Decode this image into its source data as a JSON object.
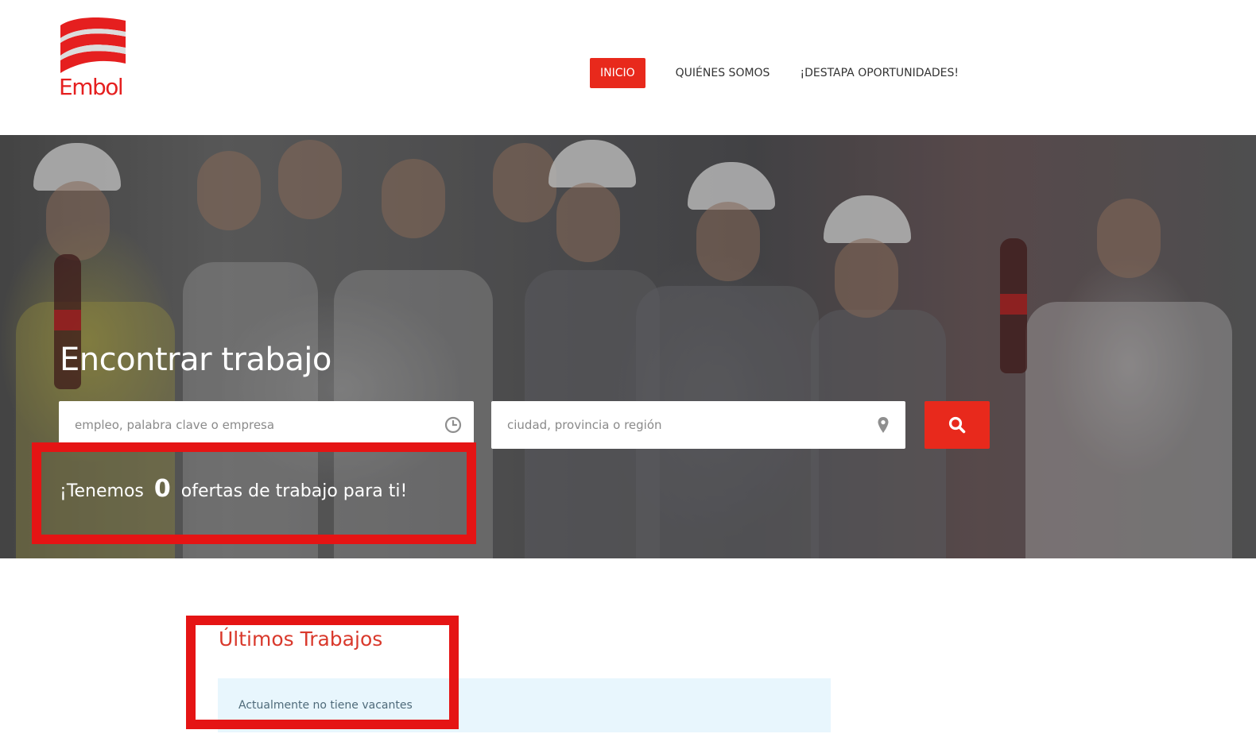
{
  "brand": {
    "logo_text": "Embol",
    "accent_color": "#e8291c"
  },
  "nav": {
    "items": [
      {
        "label": "INICIO",
        "active": true
      },
      {
        "label": "QUIÉNES SOMOS",
        "active": false
      },
      {
        "label": "¡DESTAPA OPORTUNIDADES!",
        "active": false
      }
    ]
  },
  "hero": {
    "title": "Encontrar trabajo",
    "keyword_placeholder": "empleo, palabra clave o empresa",
    "keyword_icon": "clock-icon",
    "location_placeholder": "ciudad, provincia o región",
    "location_icon": "map-pin-icon",
    "search_icon": "search-icon",
    "offers_prefix": "¡Tenemos",
    "offers_count": "0",
    "offers_suffix": "ofertas de trabajo para ti!"
  },
  "latest_jobs": {
    "title": "Últimos Trabajos",
    "empty_message": "Actualmente no tiene vacantes"
  },
  "annotation_color": "#e51414"
}
